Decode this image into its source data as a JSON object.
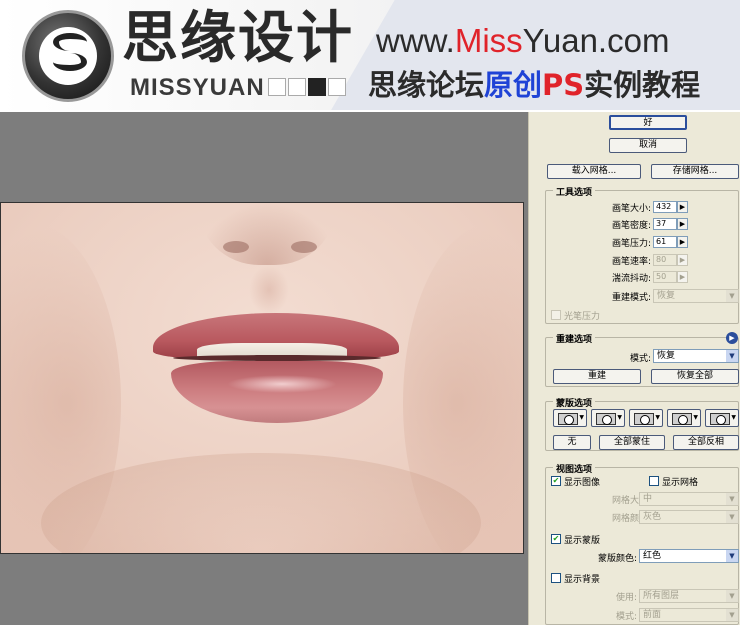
{
  "banner": {
    "logo_cn": "思缘设计",
    "logo_en": "MISSYUAN",
    "url_prefix": "www.",
    "url_red1": "Miss",
    "url_mid": "Yuan",
    "url_suffix": ".com",
    "tagline_a": "思缘论坛",
    "tagline_b": "原创",
    "tagline_c": "PS",
    "tagline_d": "实例教程"
  },
  "panel": {
    "ok_label": "好",
    "cancel_label": "取消",
    "load_mesh_label": "载入网格...",
    "save_mesh_label": "存储网格...",
    "tool_options": {
      "title": "工具选项",
      "brush_size_label": "画笔大小:",
      "brush_size_value": "432",
      "brush_density_label": "画笔密度:",
      "brush_density_value": "37",
      "brush_pressure_label": "画笔压力:",
      "brush_pressure_value": "61",
      "brush_rate_label": "画笔速率:",
      "brush_rate_value": "80",
      "turbulent_jitter_label": "湍流抖动:",
      "turbulent_jitter_value": "50",
      "reconstruct_mode_label": "重建模式:",
      "reconstruct_mode_value": "恢复",
      "stylus_pressure_label": "光笔压力"
    },
    "reconstruct_options": {
      "title": "重建选项",
      "mode_label": "模式:",
      "mode_value": "恢复",
      "reconstruct_label": "重建",
      "restore_all_label": "恢复全部"
    },
    "mask_options": {
      "title": "蒙版选项",
      "none_label": "无",
      "mask_all_label": "全部蒙住",
      "invert_all_label": "全部反相"
    },
    "view_options": {
      "title": "视图选项",
      "show_image_label": "显示图像",
      "show_mesh_label": "显示网格",
      "mesh_size_label": "网格大小:",
      "mesh_size_value": "中",
      "mesh_color_label": "网格颜色:",
      "mesh_color_value": "灰色",
      "show_mask_label": "显示蒙版",
      "mask_color_label": "蒙版颜色:",
      "mask_color_value": "红色",
      "show_backdrop_label": "显示背景",
      "use_label": "使用:",
      "use_value": "所有图层",
      "mode_label": "模式:",
      "mode_value": "前面"
    }
  },
  "colors": {
    "accent_red": "#e0232a",
    "accent_blue": "#1f43d6",
    "panel_bg": "#ece9d8",
    "canvas_bg": "#7d7d7d"
  }
}
